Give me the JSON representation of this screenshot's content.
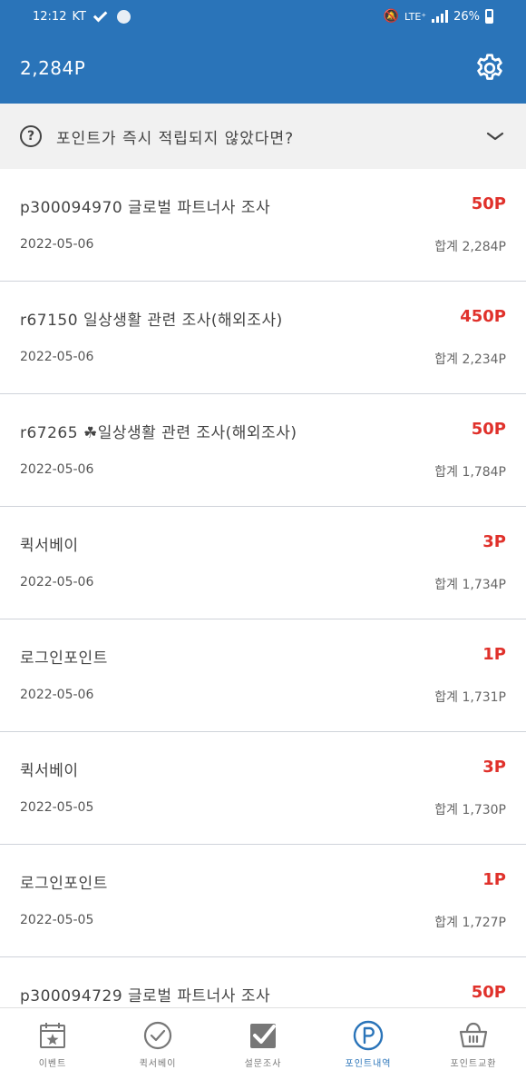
{
  "status_bar": {
    "time": "12:12",
    "carrier": "KT",
    "network": "LTE⁺",
    "battery": "26%"
  },
  "header": {
    "points": "2,284P",
    "settings_icon": "gear-icon"
  },
  "help": {
    "text": "포인트가 즉시 적립되지 않았다면?",
    "icon": "question-circle-icon"
  },
  "transactions": [
    {
      "title": "p300094970 글로벌 파트너사 조사",
      "amount": "50P",
      "date": "2022-05-06",
      "total": "합계 2,284P"
    },
    {
      "title": "r67150 일상생활 관련 조사(해외조사)",
      "amount": "450P",
      "date": "2022-05-06",
      "total": "합계 2,234P"
    },
    {
      "title": "r67265 ☘일상생활 관련 조사(해외조사)",
      "amount": "50P",
      "date": "2022-05-06",
      "total": "합계 1,784P"
    },
    {
      "title": "퀵서베이",
      "amount": "3P",
      "date": "2022-05-06",
      "total": "합계 1,734P"
    },
    {
      "title": "로그인포인트",
      "amount": "1P",
      "date": "2022-05-06",
      "total": "합계 1,731P"
    },
    {
      "title": "퀵서베이",
      "amount": "3P",
      "date": "2022-05-05",
      "total": "합계 1,730P"
    },
    {
      "title": "로그인포인트",
      "amount": "1P",
      "date": "2022-05-05",
      "total": "합계 1,727P"
    },
    {
      "title": "p300094729 글로벌 파트너사 조사",
      "amount": "50P",
      "date": "",
      "total": ""
    }
  ],
  "nav": [
    {
      "label": "이벤트",
      "icon": "calendar-star-icon"
    },
    {
      "label": "퀵서베이",
      "icon": "check-circle-icon"
    },
    {
      "label": "설문조사",
      "icon": "checkbox-icon"
    },
    {
      "label": "포인트내역",
      "icon": "p-circle-icon",
      "active": true
    },
    {
      "label": "포인트교환",
      "icon": "basket-icon"
    }
  ],
  "colors": {
    "primary": "#2a74b9",
    "amount": "#e0312b"
  }
}
